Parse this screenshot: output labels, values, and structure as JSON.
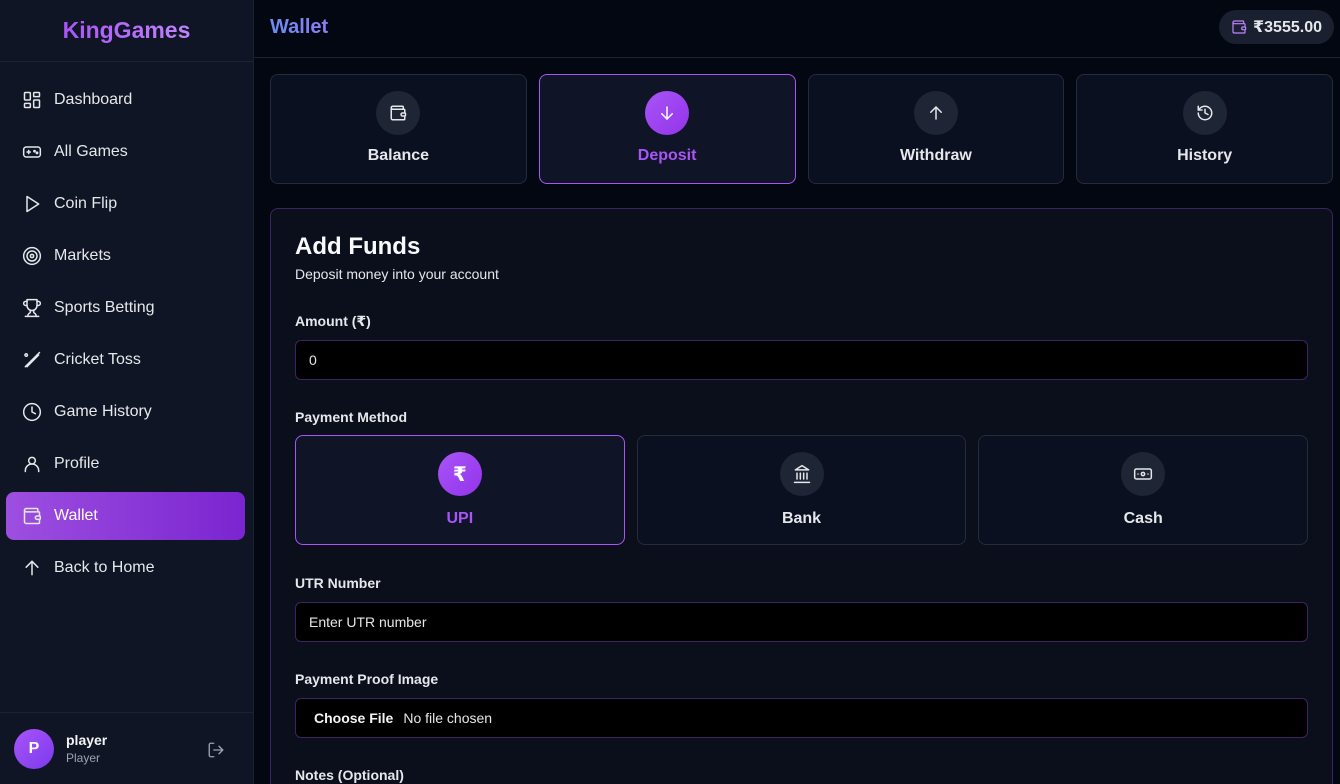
{
  "app": {
    "brand": "KingGames"
  },
  "sidebar": {
    "items": [
      {
        "label": "Dashboard",
        "icon": "dashboard-icon"
      },
      {
        "label": "All Games",
        "icon": "gamepad-icon"
      },
      {
        "label": "Coin Flip",
        "icon": "play-icon"
      },
      {
        "label": "Markets",
        "icon": "target-icon"
      },
      {
        "label": "Sports Betting",
        "icon": "trophy-icon"
      },
      {
        "label": "Cricket Toss",
        "icon": "cricket-bat-icon"
      },
      {
        "label": "Game History",
        "icon": "clock-icon"
      },
      {
        "label": "Profile",
        "icon": "user-icon"
      },
      {
        "label": "Wallet",
        "icon": "wallet-icon",
        "active": true
      },
      {
        "label": "Back to Home",
        "icon": "arrow-up-icon"
      }
    ],
    "user": {
      "initial": "P",
      "name": "player",
      "role": "Player"
    }
  },
  "header": {
    "title": "Wallet",
    "balance": "₹3555.00"
  },
  "tabs": [
    {
      "label": "Balance",
      "icon": "wallet-icon"
    },
    {
      "label": "Deposit",
      "icon": "arrow-down-icon",
      "active": true
    },
    {
      "label": "Withdraw",
      "icon": "arrow-up-icon"
    },
    {
      "label": "History",
      "icon": "history-icon"
    }
  ],
  "form": {
    "title": "Add Funds",
    "subtitle": "Deposit money into your account",
    "amount_label": "Amount (₹)",
    "amount_value": "0",
    "method_label": "Payment Method",
    "methods": [
      {
        "label": "UPI",
        "symbol": "₹",
        "active": true
      },
      {
        "label": "Bank",
        "icon": "bank-icon"
      },
      {
        "label": "Cash",
        "icon": "cash-icon"
      }
    ],
    "utr_label": "UTR Number",
    "utr_placeholder": "Enter UTR number",
    "proof_label": "Payment Proof Image",
    "file_button": "Choose File",
    "file_status": "No file chosen",
    "notes_label": "Notes (Optional)"
  },
  "colors": {
    "accent": "#a855f7",
    "background": "#030712",
    "sidebar": "#0f1524"
  }
}
